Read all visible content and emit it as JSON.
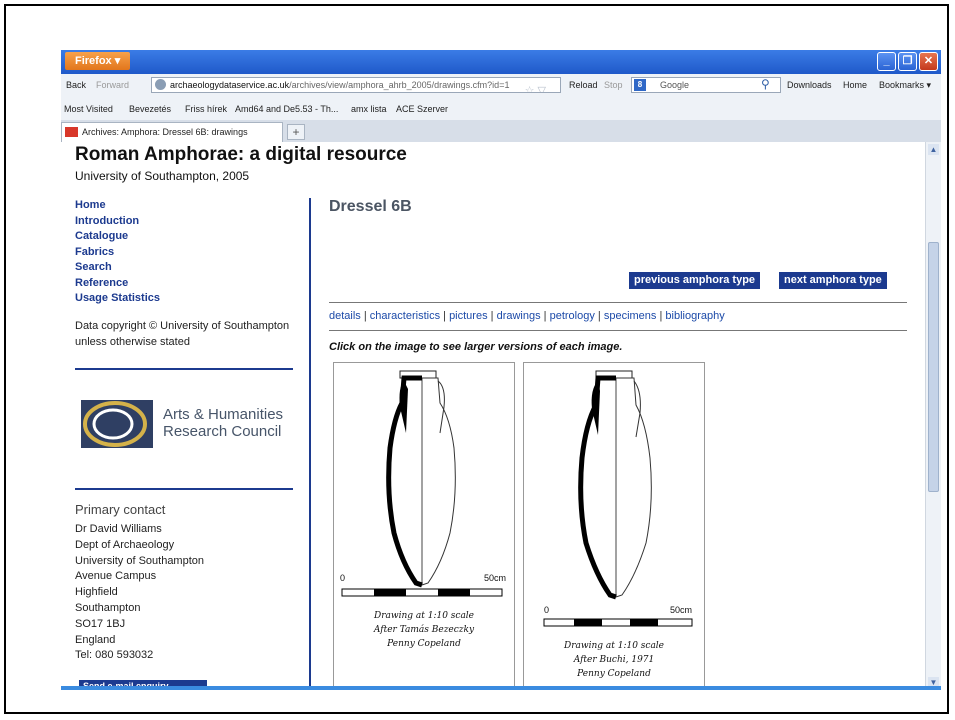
{
  "browser": {
    "firefox_btn": "Firefox",
    "back": "Back",
    "forward": "Forward",
    "url_domain": "archaeologydataservice.ac.uk",
    "url_path": "/archives/view/amphora_ahrb_2005/drawings.cfm?id=1",
    "reload": "Reload",
    "stop": "Stop",
    "search_engine": "Google",
    "downloads": "Downloads",
    "home": "Home",
    "bookmarks": "Bookmarks",
    "bookmarks_bar": [
      "Most Visited",
      "Bevezetés",
      "Friss hírek",
      "Amd64 and De5.53 - Th...",
      "amx lista",
      "ACE Szerver"
    ],
    "tab_title": "Archives: Amphora: Dressel 6B: drawings"
  },
  "site": {
    "title": "Roman Amphorae: a digital resource",
    "subtitle": "University of Southampton, 2005"
  },
  "nav": [
    "Home",
    "Introduction",
    "Catalogue",
    "Fabrics",
    "Search",
    "Reference",
    "Usage Statistics"
  ],
  "copyright": "Data copyright © University of Southampton unless otherwise stated",
  "ahrc": {
    "line1": "Arts & Humanities",
    "line2": "Research Council"
  },
  "contact": {
    "heading": "Primary contact",
    "lines": [
      "Dr David Williams",
      "Dept of Archaeology",
      "University of Southampton",
      "Avenue Campus",
      "Highfield",
      "Southampton",
      "SO17 1BJ",
      "England",
      "Tel: 080 593032"
    ],
    "email_button": "Send e-mail enquiry"
  },
  "page": {
    "heading": "Dressel 6B",
    "prev_button": "previous amphora type",
    "next_button": "next amphora type",
    "tabs": [
      "details",
      "characteristics",
      "pictures",
      "drawings",
      "petrology",
      "specimens",
      "bibliography"
    ],
    "instruction": "Click on the image to see larger versions of each image."
  },
  "drawings": [
    {
      "scale_start": "0",
      "scale_end": "50cm",
      "caption": [
        "Drawing at 1:10 scale",
        "After Tamás Bezeczky",
        "Penny Copeland"
      ]
    },
    {
      "scale_start": "0",
      "scale_end": "50cm",
      "caption": [
        "Drawing at 1:10 scale",
        "After Buchi, 1971",
        "Penny Copeland"
      ]
    }
  ],
  "colors": {
    "link": "#1c4aa8",
    "nav": "#1c3a8f",
    "titlebar": "#245fd0",
    "firefox": "#e8812c"
  }
}
